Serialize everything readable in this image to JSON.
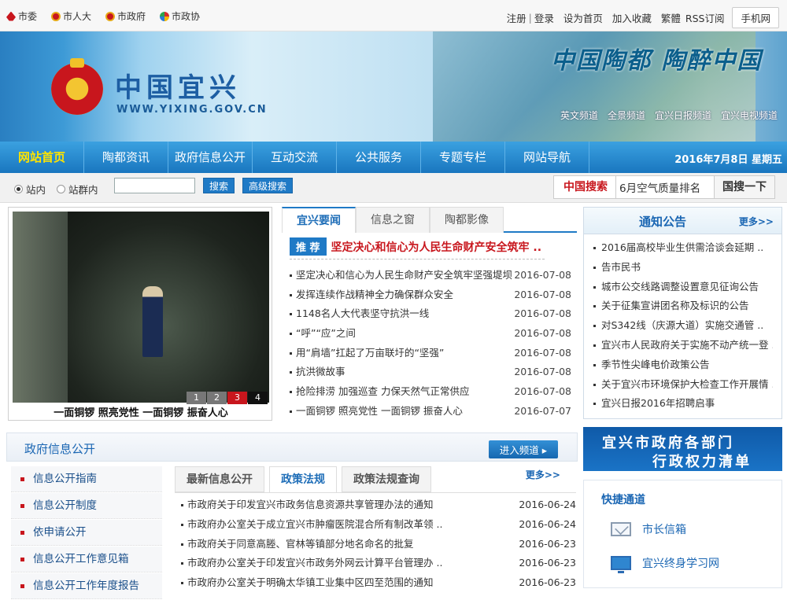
{
  "topbar": {
    "links": [
      "市委",
      "市人大",
      "市政府",
      "市政协"
    ],
    "register": "注册",
    "login": "登录",
    "set_home": "设为首页",
    "favorite": "加入收藏",
    "traditional": "繁體",
    "rss": "RSS订阅",
    "mobile": "手机网"
  },
  "banner": {
    "site_name": "中国宜兴",
    "site_url": "WWW.YIXING.GOV.CN",
    "slogan": "中国陶都 陶醉中国",
    "channels": [
      "英文频道",
      "全景频道",
      "宜兴日报频道",
      "宜兴电视频道"
    ]
  },
  "nav": {
    "items": [
      "网站首页",
      "陶都资讯",
      "政府信息公开",
      "互动交流",
      "公共服务",
      "专题专栏",
      "网站导航"
    ],
    "date": "2016年7月8日 星期五"
  },
  "search": {
    "scope_site": "站内",
    "scope_group": "站群内",
    "search_button": "搜索",
    "advanced_button": "高级搜索",
    "china_search_label": "中国搜索",
    "china_search_query": "6月空气质量排名",
    "china_search_go": "国搜一下"
  },
  "slideshow": {
    "caption": "一面铜锣 照亮党性 一面铜锣 振奋人心",
    "pages": [
      "1",
      "2",
      "3",
      "4"
    ],
    "active_page": 3
  },
  "news": {
    "tabs": [
      "宜兴要闻",
      "信息之窗",
      "陶都影像"
    ],
    "recommend_badge": "推 荐",
    "recommend_title": "坚定决心和信心为人民生命财产安全筑牢 ..",
    "items": [
      {
        "title": "坚定决心和信心为人民生命财产安全筑牢坚强堤坝",
        "date": "2016-07-08"
      },
      {
        "title": "发挥连续作战精神全力确保群众安全",
        "date": "2016-07-08"
      },
      {
        "title": "1148名人大代表坚守抗洪一线",
        "date": "2016-07-08"
      },
      {
        "title": "“呼”“应”之间",
        "date": "2016-07-08"
      },
      {
        "title": "用“肩墙”扛起了万亩联圩的“坚强”",
        "date": "2016-07-08"
      },
      {
        "title": "抗洪微故事",
        "date": "2016-07-08"
      },
      {
        "title": "抢险排涝 加强巡查 力保天然气正常供应",
        "date": "2016-07-08"
      },
      {
        "title": "一面铜锣 照亮党性 一面铜锣 振奋人心",
        "date": "2016-07-07"
      }
    ]
  },
  "notice": {
    "title": "通知公告",
    "more": "更多>>",
    "items": [
      "2016届高校毕业生供需洽谈会延期 ..",
      "告市民书",
      "城市公交线路调整设置意见征询公告",
      "关于征集宣讲团名称及标识的公告",
      "对S342线（庆源大道）实施交通管 ..",
      "宜兴市人民政府关于实施不动产统一登 ..",
      "季节性尖峰电价政策公告",
      "关于宜兴市环境保护大检查工作开展情 ..",
      "宜兴日报2016年招聘启事"
    ]
  },
  "gov_info": {
    "title": "政府信息公开",
    "enter": "进入频道",
    "side_items": [
      "信息公开指南",
      "信息公开制度",
      "依申请公开",
      "信息公开工作意见箱",
      "信息公开工作年度报告"
    ],
    "tabs": [
      "最新信息公开",
      "政策法规",
      "政策法规查询"
    ],
    "more": "更多>>",
    "items": [
      {
        "title": "市政府关于印发宜兴市政务信息资源共享管理办法的通知",
        "date": "2016-06-24"
      },
      {
        "title": "市政府办公室关于成立宜兴市肿瘤医院混合所有制改革领 ..",
        "date": "2016-06-24"
      },
      {
        "title": "市政府关于同意高塍、官林等镇部分地名命名的批复",
        "date": "2016-06-23"
      },
      {
        "title": "市政府办公室关于印发宜兴市政务外网云计算平台管理办 ..",
        "date": "2016-06-23"
      },
      {
        "title": "市政府办公室关于明确太华镇工业集中区四至范围的通知",
        "date": "2016-06-23"
      }
    ]
  },
  "power_list": {
    "line1": "宜兴市政府各部门",
    "line2": "行政权力清单"
  },
  "quick": {
    "title": "快捷通道",
    "items": [
      "市长信箱",
      "宜兴终身学习网"
    ]
  }
}
